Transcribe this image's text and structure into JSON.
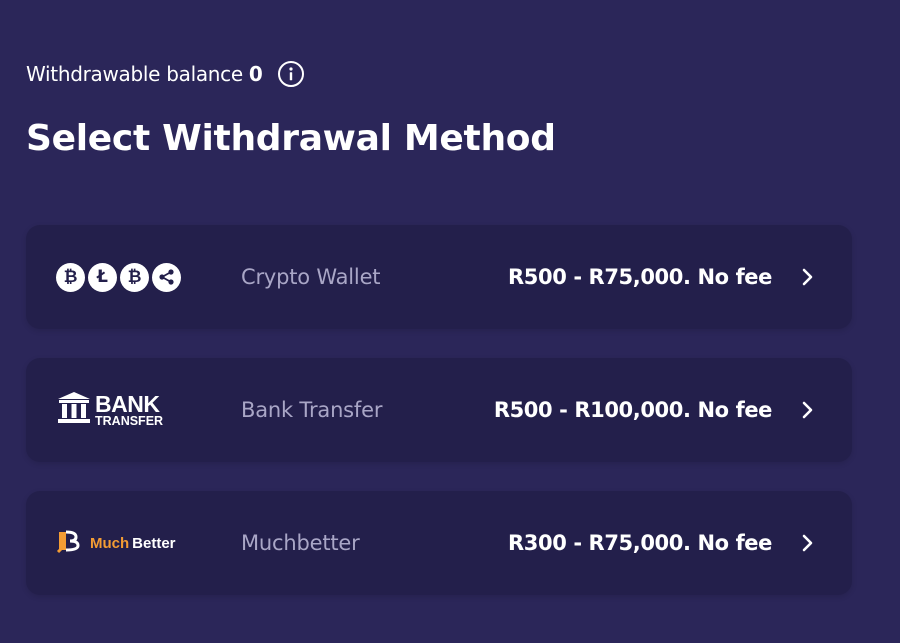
{
  "balance": {
    "label": "Withdrawable balance",
    "value": "0",
    "info_icon": "info-circle-icon"
  },
  "page_title": "Select Withdrawal Method",
  "methods": [
    {
      "name": "Crypto Wallet",
      "range": "R500 - R75,000. No fee",
      "logo_icons": [
        "bitcoin-icon",
        "litecoin-icon",
        "bitcoin-cash-icon",
        "ripple-icon"
      ]
    },
    {
      "name": "Bank Transfer",
      "range": "R500 - R100,000. No fee",
      "logo": {
        "big": "BANK",
        "small": "TRANSFER",
        "icon": "bank-building-icon"
      }
    },
    {
      "name": "Muchbetter",
      "range": "R300 - R75,000. No fee",
      "logo": {
        "much": "Much",
        "better": "Better",
        "icon": "muchbetter-b-icon"
      }
    }
  ],
  "colors": {
    "background": "#2b2659",
    "card": "#231f4b",
    "muted_text": "#a9a6c6",
    "muchbetter_orange": "#f39c34"
  }
}
